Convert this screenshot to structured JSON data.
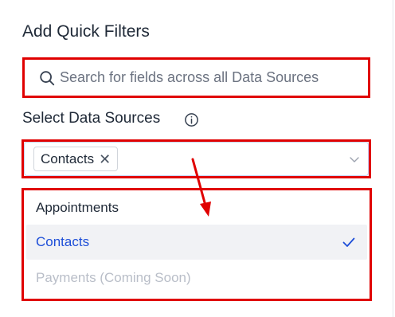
{
  "panel": {
    "title": "Add Quick Filters",
    "search": {
      "placeholder": "Search for fields across all Data Sources",
      "value": ""
    },
    "data_sources": {
      "label": "Select Data Sources",
      "selected_chips": [
        {
          "label": "Contacts",
          "remove_glyph": "✕"
        }
      ],
      "options": [
        {
          "label": "Appointments",
          "state": "default"
        },
        {
          "label": "Contacts",
          "state": "selected"
        },
        {
          "label": "Payments (Coming Soon)",
          "state": "disabled"
        }
      ]
    }
  },
  "icons": {
    "search": "search-icon",
    "info": "info-icon",
    "chevron": "chevron-down-icon",
    "check": "check-icon",
    "annotation_arrow": "arrow-down-icon"
  },
  "colors": {
    "annotation_red": "#e00000",
    "accent_blue": "#1d4ed8",
    "selected_row_bg": "#f1f2f5",
    "disabled_text": "#b9bec8",
    "text_primary": "#1f2937"
  }
}
